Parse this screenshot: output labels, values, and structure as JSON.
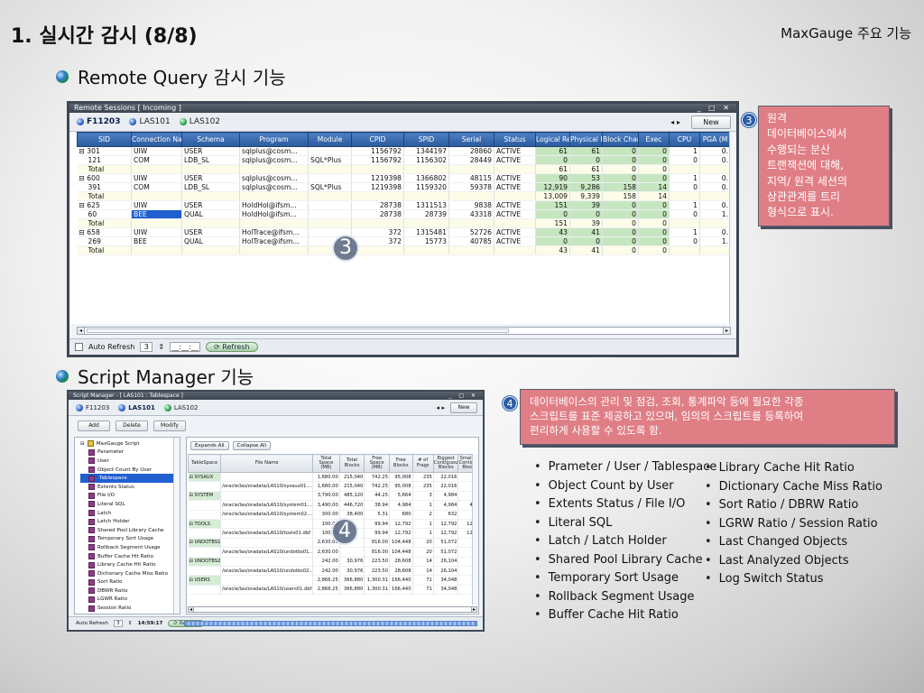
{
  "header": {
    "title": "1. 실시간 감시 (8/8)",
    "brand": "MaxGauge  주요 기능"
  },
  "section1": {
    "title": "Remote Query 감시 기능"
  },
  "section2": {
    "title": "Script Manager 기능"
  },
  "remote_window": {
    "title": "Remote Sessions [ Incoming ]",
    "controls": "_ □ ✕",
    "tabs": [
      {
        "label": "F11203",
        "active": true
      },
      {
        "label": "LAS101",
        "active": false
      },
      {
        "label": "LAS102",
        "active": false
      }
    ],
    "nav_arrows": "◂ ▸",
    "new_label": "New",
    "columns": [
      "SID",
      "Connection Name",
      "Schema",
      "Program",
      "Module",
      "CPID",
      "SPID",
      "Serial",
      "Status",
      "Logical Reads",
      "Physical Reads",
      "Block Changes",
      "Exec",
      "CPU",
      "PGA (M"
    ],
    "rows": [
      {
        "kind": "parent",
        "sid": "⊟ 301",
        "conn": "UIW",
        "schema": "USER",
        "program": "sqlplus@cosm...",
        "module": "",
        "cpid": "1156792",
        "spid": "1344197",
        "serial": "28860",
        "status": "ACTIVE",
        "lr": "61",
        "pr": "61",
        "bc": "0",
        "exec": "0",
        "cpu": "1",
        "pga": "0."
      },
      {
        "kind": "child",
        "sid": "121",
        "conn": "COM",
        "schema": "LDB_SL",
        "program": "sqlplus@cosm...",
        "module": "SQL*Plus",
        "cpid": "1156792",
        "spid": "1156302",
        "serial": "28449",
        "status": "ACTIVE",
        "lr": "0",
        "pr": "0",
        "bc": "0",
        "exec": "0",
        "cpu": "0",
        "pga": "0."
      },
      {
        "kind": "total",
        "sid": "Total",
        "conn": "",
        "schema": "",
        "program": "",
        "module": "",
        "cpid": "",
        "spid": "",
        "serial": "",
        "status": "",
        "lr": "61",
        "pr": "61",
        "bc": "0",
        "exec": "0",
        "cpu": "",
        "pga": ""
      },
      {
        "kind": "parent",
        "sid": "⊟ 600",
        "conn": "UIW",
        "schema": "USER",
        "program": "sqlplus@cosm...",
        "module": "",
        "cpid": "1219398",
        "spid": "1366802",
        "serial": "48115",
        "status": "ACTIVE",
        "lr": "90",
        "pr": "53",
        "bc": "0",
        "exec": "0",
        "cpu": "1",
        "pga": "0."
      },
      {
        "kind": "child",
        "sid": "391",
        "conn": "COM",
        "schema": "LDB_SL",
        "program": "sqlplus@cosm...",
        "module": "SQL*Plus",
        "cpid": "1219398",
        "spid": "1159320",
        "serial": "59378",
        "status": "ACTIVE",
        "lr": "12,919",
        "pr": "9,286",
        "bc": "158",
        "exec": "14",
        "cpu": "0",
        "pga": "0."
      },
      {
        "kind": "total",
        "sid": "Total",
        "conn": "",
        "schema": "",
        "program": "",
        "module": "",
        "cpid": "",
        "spid": "",
        "serial": "",
        "status": "",
        "lr": "13,009",
        "pr": "9,339",
        "bc": "158",
        "exec": "14",
        "cpu": "",
        "pga": ""
      },
      {
        "kind": "parent",
        "sid": "⊟ 625",
        "conn": "UIW",
        "schema": "USER",
        "program": "HoldHol@ifsm...",
        "module": "",
        "cpid": "28738",
        "spid": "1311513",
        "serial": "9838",
        "status": "ACTIVE",
        "lr": "151",
        "pr": "39",
        "bc": "0",
        "exec": "0",
        "cpu": "1",
        "pga": "0."
      },
      {
        "kind": "child",
        "sid": "60",
        "conn": "BEE",
        "schema": "QUAL",
        "program": "HoldHol@ifsm...",
        "module": "",
        "cpid": "28738",
        "spid": "28739",
        "serial": "43318",
        "status": "ACTIVE",
        "lr": "0",
        "pr": "0",
        "bc": "0",
        "exec": "0",
        "cpu": "0",
        "pga": "1.",
        "selected": true
      },
      {
        "kind": "total",
        "sid": "Total",
        "conn": "",
        "schema": "",
        "program": "",
        "module": "",
        "cpid": "",
        "spid": "",
        "serial": "",
        "status": "",
        "lr": "151",
        "pr": "39",
        "bc": "0",
        "exec": "0",
        "cpu": "",
        "pga": ""
      },
      {
        "kind": "parent",
        "sid": "⊟ 658",
        "conn": "UIW",
        "schema": "USER",
        "program": "HolTrace@ifsm...",
        "module": "",
        "cpid": "372",
        "spid": "1315481",
        "serial": "52726",
        "status": "ACTIVE",
        "lr": "43",
        "pr": "41",
        "bc": "0",
        "exec": "0",
        "cpu": "1",
        "pga": "0."
      },
      {
        "kind": "child",
        "sid": "269",
        "conn": "BEE",
        "schema": "QUAL",
        "program": "HolTrace@ifsm...",
        "module": "",
        "cpid": "372",
        "spid": "15773",
        "serial": "40785",
        "status": "ACTIVE",
        "lr": "0",
        "pr": "0",
        "bc": "0",
        "exec": "0",
        "cpu": "0",
        "pga": "1."
      },
      {
        "kind": "total",
        "sid": "Total",
        "conn": "",
        "schema": "",
        "program": "",
        "module": "",
        "cpid": "",
        "spid": "",
        "serial": "",
        "status": "",
        "lr": "43",
        "pr": "41",
        "bc": "0",
        "exec": "0",
        "cpu": "",
        "pga": ""
      }
    ],
    "status_bar": {
      "auto_refresh_label": "Auto Refresh",
      "interval": "3",
      "time": "__:__:__",
      "refresh_label": "Refresh"
    }
  },
  "callout3": {
    "number": "3",
    "lines": [
      "원격",
      "데이터베이스에서",
      "수행되는 분산",
      "트랜잭션에 대해,",
      "지역/ 원격 세션의",
      "상관관계를 트리",
      "형식으로 표시."
    ]
  },
  "callout4": {
    "number": "4",
    "lines": [
      "데이터베이스의 관리 및 점검, 조회, 통계파악 등에 필요한 각종",
      "스크립트를 표준 제공하고 있으며, 임의의 스크립트를 등록하여",
      "편리하게 사용할 수 있도록 함."
    ]
  },
  "script_window": {
    "title": "Script Manager - [ LAS101 : Tablespace ]",
    "controls": "_ □ ✕",
    "tabs": [
      {
        "label": "F11203",
        "active": false
      },
      {
        "label": "LAS101",
        "active": true
      },
      {
        "label": "LAS102",
        "active": false
      }
    ],
    "nav_arrows": "◂ ▸",
    "new_label": "New",
    "buttons": [
      "Add",
      "Delete",
      "Modify"
    ],
    "tree_root": "MaxGauge Script",
    "tree_items": [
      "Parameter",
      "User",
      "Object Count By User",
      "Tablespace",
      "Extents Status",
      "File I/O",
      "Literal SQL",
      "Latch",
      "Latch Holder",
      "Shared Pool Library Cache",
      "Temporary Sort Usage",
      "Rollback Segment Usage",
      "Buffer Cache Hit Ratio",
      "Library Cache Hit Ratio",
      "Dictionary Cache Miss Ratio",
      "Sort Ratio",
      "DBWR Ratio",
      "LGWR Ratio",
      "Session Ratio"
    ],
    "selected_tree_item": "Tablespace",
    "expand_label": "Expands All",
    "collapse_label": "Collapse All",
    "columns": [
      "TableSpace",
      "File Name",
      "Total Space (MB)",
      "Total Blocks",
      "Free Space (MB)",
      "Free Blocks",
      "# of Frags",
      "Biggest Contiguous Blocks",
      "Smallest Contiguous Blocks"
    ],
    "rows": [
      {
        "kind": "group",
        "ts": "⊟ SYSAUX",
        "file": "",
        "total": "1,680.00",
        "blocks": "215,040",
        "free": "742.25",
        "fblocks": "95,008",
        "frags": "235",
        "big": "22,016",
        "small": "1"
      },
      {
        "kind": "file",
        "ts": "",
        "file": "/oracle/las/oradata/LAS10/sysaux01....",
        "total": "1,680.00",
        "blocks": "215,040",
        "free": "742.25",
        "fblocks": "95,008",
        "frags": "235",
        "big": "22,016",
        "small": "1"
      },
      {
        "kind": "group",
        "ts": "⊟ SYSTEM",
        "file": "",
        "total": "3,790.00",
        "blocks": "485,120",
        "free": "44.25",
        "fblocks": "5,664",
        "frags": "3",
        "big": "4,984",
        "small": "4"
      },
      {
        "kind": "file",
        "ts": "",
        "file": "/oracle/las/oradata/LAS10/system01....",
        "total": "3,490.00",
        "blocks": "446,720",
        "free": "38.94",
        "fblocks": "4,984",
        "frags": "1",
        "big": "4,984",
        "small": "4,98"
      },
      {
        "kind": "file",
        "ts": "",
        "file": "/oracle/las/oradata/LAS10/system02....",
        "total": "300.00",
        "blocks": "38,400",
        "free": "5.31",
        "fblocks": "680",
        "frags": "2",
        "big": "632",
        "small": "4"
      },
      {
        "kind": "group",
        "ts": "⊟ TOOLS",
        "file": "",
        "total": "100.00",
        "blocks": "",
        "free": "99.94",
        "fblocks": "12,792",
        "frags": "1",
        "big": "12,792",
        "small": "12,79"
      },
      {
        "kind": "file",
        "ts": "",
        "file": "/oracle/las/oradata/LAS10/tools01.dbf",
        "total": "100.00",
        "blocks": "",
        "free": "99.94",
        "fblocks": "12,792",
        "frags": "1",
        "big": "12,792",
        "small": "12,79"
      },
      {
        "kind": "group",
        "ts": "⊟ UNDOTBS1",
        "file": "",
        "total": "2,630.00",
        "blocks": "",
        "free": "816.00",
        "fblocks": "104,448",
        "frags": "20",
        "big": "51,072",
        "small": "1"
      },
      {
        "kind": "file",
        "ts": "",
        "file": "/oracle/las/oradata/LAS10/undotbs01....",
        "total": "2,630.00",
        "blocks": "",
        "free": "816.00",
        "fblocks": "104,448",
        "frags": "20",
        "big": "51,072",
        "small": "1"
      },
      {
        "kind": "group",
        "ts": "⊟ UNDOTBS2",
        "file": "",
        "total": "242.00",
        "blocks": "30,976",
        "free": "223.50",
        "fblocks": "28,608",
        "frags": "14",
        "big": "26,104",
        "small": "1"
      },
      {
        "kind": "file",
        "ts": "",
        "file": "/oracle/las/oradata/LAS10/undotbs02....",
        "total": "242.00",
        "blocks": "30,976",
        "free": "223.50",
        "fblocks": "28,608",
        "frags": "14",
        "big": "26,104",
        "small": "1"
      },
      {
        "kind": "group",
        "ts": "⊟ USERS",
        "file": "",
        "total": "2,866.25",
        "blocks": "366,880",
        "free": "1,300.31",
        "fblocks": "166,440",
        "frags": "71",
        "big": "34,048",
        "small": "1"
      },
      {
        "kind": "file",
        "ts": "",
        "file": "/oracle/las/oradata/LAS10/users01.dbf",
        "total": "2,866.25",
        "blocks": "366,880",
        "free": "1,300.31",
        "fblocks": "166,440",
        "frags": "71",
        "big": "34,048",
        "small": "1"
      }
    ],
    "status_bar": {
      "auto_refresh_label": "Auto Refresh",
      "interval": "3",
      "time": "14:59:17",
      "refresh_label": "Refresh"
    }
  },
  "feature_list_left": [
    "Prameter / User / Tablespace",
    "Object Count by User",
    "Extents Status /  File I/O",
    "Literal SQL",
    "Latch / Latch Holder",
    "Shared Pool Library Cache",
    "Temporary Sort Usage",
    "Rollback Segment Usage",
    "Buffer Cache Hit Ratio"
  ],
  "feature_list_right": [
    "Library Cache Hit Ratio",
    "Dictionary Cache Miss Ratio",
    "Sort Ratio / DBRW Ratio",
    "LGRW Ratio / Session Ratio",
    "Last Changed Objects",
    "Last Analyzed Objects",
    "Log Switch Status"
  ],
  "overlay_numbers": {
    "remote": "3",
    "script": "4"
  },
  "colors": {
    "callout": "#e07e85",
    "grid_header": "#2b5b9e",
    "highlight_green": "#c6e6bf",
    "highlight_yellow": "#fdfd55"
  }
}
